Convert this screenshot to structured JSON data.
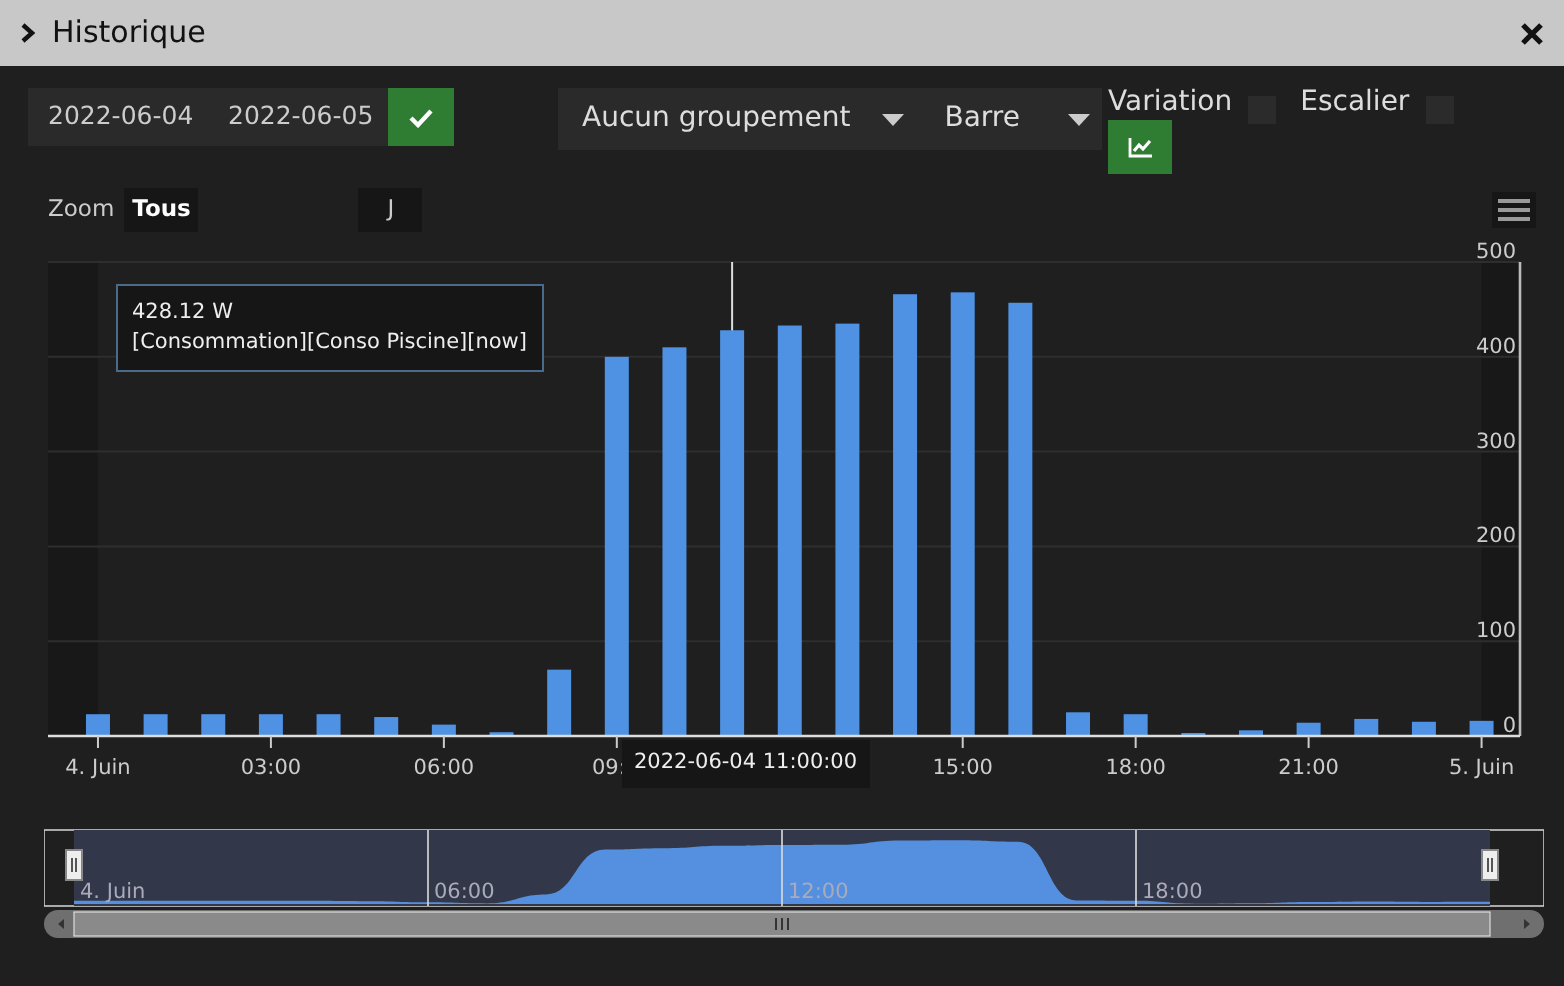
{
  "window": {
    "title": "Historique"
  },
  "toolbar": {
    "date_from": "2022-06-04",
    "date_to": "2022-06-05",
    "grouping": "Aucun groupement",
    "chart_type": "Barre",
    "options": [
      {
        "label": "Variation",
        "checked": false
      },
      {
        "label": "Escalier",
        "checked": false
      }
    ]
  },
  "chart": {
    "zoom_label": "Zoom",
    "zoom_buttons": [
      {
        "label": "Tous",
        "selected": true
      },
      {
        "label": "J",
        "selected": false
      }
    ],
    "tooltip": {
      "value": "428.12 W",
      "series": "[Consommation][Conso Piscine][now]"
    },
    "hover_label": "2022-06-04 11:00:00",
    "chart_data": {
      "type": "bar",
      "grid": "y",
      "x": [
        "2022-06-04T00:00",
        "2022-06-04T01:00",
        "2022-06-04T02:00",
        "2022-06-04T03:00",
        "2022-06-04T04:00",
        "2022-06-04T05:00",
        "2022-06-04T06:00",
        "2022-06-04T07:00",
        "2022-06-04T08:00",
        "2022-06-04T09:00",
        "2022-06-04T10:00",
        "2022-06-04T11:00",
        "2022-06-04T12:00",
        "2022-06-04T13:00",
        "2022-06-04T14:00",
        "2022-06-04T15:00",
        "2022-06-04T16:00",
        "2022-06-04T17:00",
        "2022-06-04T18:00",
        "2022-06-04T19:00",
        "2022-06-04T20:00",
        "2022-06-04T21:00",
        "2022-06-04T22:00",
        "2022-06-04T23:00",
        "2022-06-05T00:00"
      ],
      "values": [
        23,
        23,
        23,
        23,
        23,
        20,
        12,
        4,
        70,
        400,
        410,
        428,
        433,
        435,
        466,
        468,
        457,
        25,
        23,
        2,
        6,
        14,
        18,
        15,
        16
      ],
      "xlim": [
        "2022-06-03T23:08",
        "2022-06-05T00:40"
      ],
      "xticks": [
        {
          "value": "2022-06-04T00:00",
          "label": "4. Juin"
        },
        {
          "value": "2022-06-04T03:00",
          "label": "03:00"
        },
        {
          "value": "2022-06-04T06:00",
          "label": "06:00"
        },
        {
          "value": "2022-06-04T09:00",
          "label": "09:"
        },
        {
          "value": "2022-06-04T15:00",
          "label": "15:00"
        },
        {
          "value": "2022-06-04T18:00",
          "label": "18:00"
        },
        {
          "value": "2022-06-04T21:00",
          "label": "21:00"
        },
        {
          "value": "2022-06-05T00:00",
          "label": "5. Juin"
        }
      ],
      "ylim": [
        0,
        500
      ],
      "yticks": [
        0,
        100,
        200,
        300,
        400,
        500
      ],
      "bands": [
        {
          "axis": "x",
          "from": "2022-06-03T23:08",
          "to": "2022-06-04T00:00"
        },
        {
          "axis": "x",
          "from": "2022-06-05T00:00",
          "to": "2022-06-05T00:40"
        }
      ],
      "ref_lines": [
        {
          "axis": "x",
          "value": "2022-06-04T11:00"
        }
      ]
    }
  },
  "navigator": {
    "labels": [
      "4. Juin",
      "06:00",
      "12:00",
      "18:00"
    ]
  }
}
